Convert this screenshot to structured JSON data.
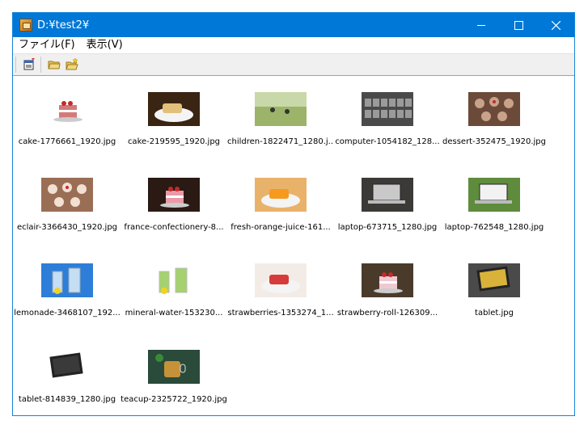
{
  "window": {
    "title": "D:¥test2¥"
  },
  "menu": {
    "file": "ファイル(F)",
    "view": "表示(V)"
  },
  "toolbar": {
    "buttons": [
      {
        "name": "properties-icon"
      },
      {
        "name": "open-folder-icon"
      },
      {
        "name": "new-folder-icon"
      }
    ]
  },
  "files": [
    {
      "name": "cake-1776661_1920.jpg",
      "bg": "#ffffff",
      "fg": "#d47a7a",
      "shape": "cake"
    },
    {
      "name": "cake-219595_1920.jpg",
      "bg": "#3a2412",
      "fg": "#e2c07a",
      "shape": "plate"
    },
    {
      "name": "children-1822471_1280.j...",
      "bg": "#5b7a3a",
      "fg": "#9bb46a",
      "shape": "field"
    },
    {
      "name": "computer-1054182_128...",
      "bg": "#4a4a4a",
      "fg": "#9a9a9a",
      "shape": "keys"
    },
    {
      "name": "dessert-352475_1920.jpg",
      "bg": "#6b4a3a",
      "fg": "#c9a28a",
      "shape": "cupcakes"
    },
    {
      "name": "eclair-3366430_1920.jpg",
      "bg": "#9a6e55",
      "fg": "#f2e0d2",
      "shape": "cupcakes"
    },
    {
      "name": "france-confectionery-8...",
      "bg": "#2b1a14",
      "fg": "#e89aa8",
      "shape": "cake"
    },
    {
      "name": "fresh-orange-juice-161...",
      "bg": "#e9b26a",
      "fg": "#f59a1f",
      "shape": "plate"
    },
    {
      "name": "laptop-673715_1280.jpg",
      "bg": "#3b3a36",
      "fg": "#c9c9c9",
      "shape": "laptop"
    },
    {
      "name": "laptop-762548_1280.jpg",
      "bg": "#5e8c3c",
      "fg": "#f2f2f2",
      "shape": "laptop"
    },
    {
      "name": "lemonade-3468107_192...",
      "bg": "#2d7ed8",
      "fg": "#eaf6fb",
      "shape": "glasses"
    },
    {
      "name": "mineral-water-153230...",
      "bg": "#ffffff",
      "fg": "#8fc84a",
      "shape": "glasses"
    },
    {
      "name": "strawberries-1353274_1...",
      "bg": "#f3ece6",
      "fg": "#d63a3a",
      "shape": "plate"
    },
    {
      "name": "strawberry-roll-126309...",
      "bg": "#4a3a2a",
      "fg": "#f0c8d2",
      "shape": "cake"
    },
    {
      "name": "tablet.jpg",
      "bg": "#4a4a4a",
      "fg": "#d9b23a",
      "shape": "tablet"
    },
    {
      "name": "tablet-814839_1280.jpg",
      "bg": "#ffffff",
      "fg": "#3a3a3a",
      "shape": "tablet"
    },
    {
      "name": "teacup-2325722_1920.jpg",
      "bg": "#2a4a3a",
      "fg": "#d79a3a",
      "shape": "teacup"
    }
  ]
}
